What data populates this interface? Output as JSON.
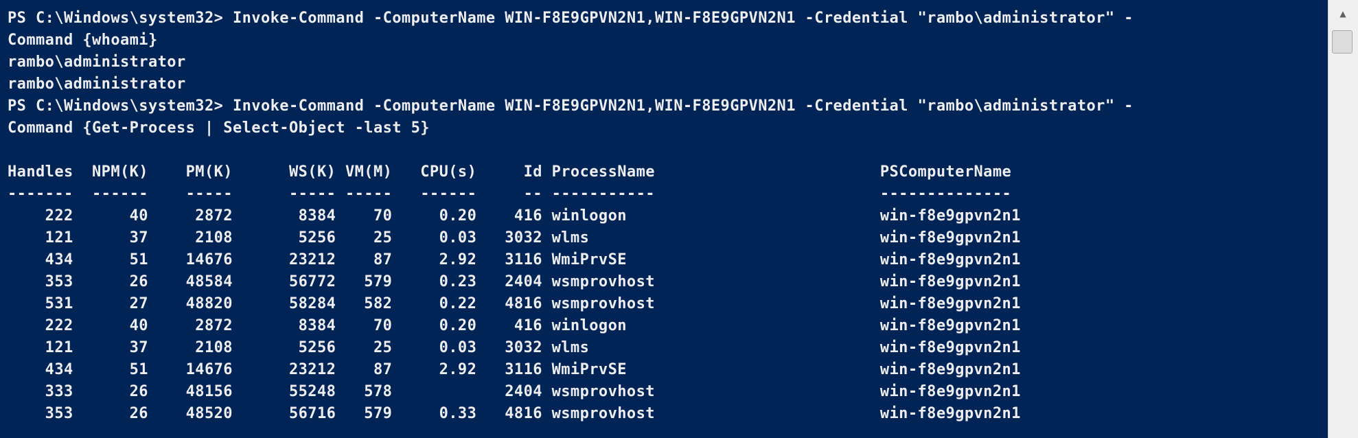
{
  "console": {
    "lines": [
      "PS C:\\Windows\\system32> Invoke-Command -ComputerName WIN-F8E9GPVN2N1,WIN-F8E9GPVN2N1 -Credential \"rambo\\administrator\" -",
      "Command {whoami}",
      "rambo\\administrator",
      "rambo\\administrator",
      "PS C:\\Windows\\system32> Invoke-Command -ComputerName WIN-F8E9GPVN2N1,WIN-F8E9GPVN2N1 -Credential \"rambo\\administrator\" -",
      "Command {Get-Process | Select-Object -last 5}",
      "",
      "Handles  NPM(K)    PM(K)      WS(K) VM(M)   CPU(s)     Id ProcessName                        PSComputerName",
      "-------  ------    -----      ----- -----   ------     -- -----------                        --------------",
      "    222      40     2872       8384    70     0.20    416 winlogon                           win-f8e9gpvn2n1",
      "    121      37     2108       5256    25     0.03   3032 wlms                               win-f8e9gpvn2n1",
      "    434      51    14676      23212    87     2.92   3116 WmiPrvSE                           win-f8e9gpvn2n1",
      "    353      26    48584      56772   579     0.23   2404 wsmprovhost                        win-f8e9gpvn2n1",
      "    531      27    48820      58284   582     0.22   4816 wsmprovhost                        win-f8e9gpvn2n1",
      "    222      40     2872       8384    70     0.20    416 winlogon                           win-f8e9gpvn2n1",
      "    121      37     2108       5256    25     0.03   3032 wlms                               win-f8e9gpvn2n1",
      "    434      51    14676      23212    87     2.92   3116 WmiPrvSE                           win-f8e9gpvn2n1",
      "    333      26    48156      55248   578            2404 wsmprovhost                        win-f8e9gpvn2n1",
      "    353      26    48520      56716   579     0.33   4816 wsmprovhost                        win-f8e9gpvn2n1"
    ]
  },
  "scrollbar": {
    "up_icon": "▲"
  },
  "colors": {
    "console_background": "#012456",
    "console_text": "#eeedf0",
    "scrollbar_track": "#f0f0f0"
  }
}
